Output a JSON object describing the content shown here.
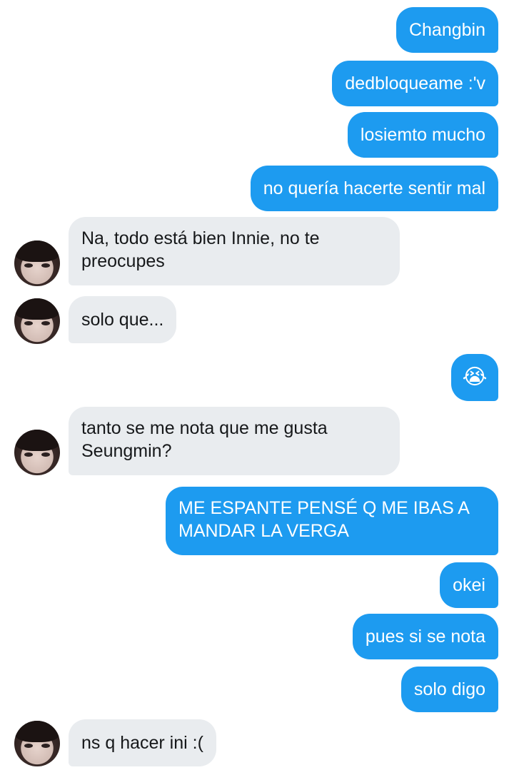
{
  "messages": [
    {
      "from": "me",
      "text": "Changbin"
    },
    {
      "from": "me",
      "text": "dedbloqueame :'v"
    },
    {
      "from": "me",
      "text": "losiemto mucho"
    },
    {
      "from": "me",
      "text": "no quería hacerte sentir mal"
    },
    {
      "from": "them",
      "text": "Na, todo está bien Innie, no te preocupes"
    },
    {
      "from": "them",
      "text": "solo que..."
    },
    {
      "from": "me",
      "text": "😭"
    },
    {
      "from": "them",
      "text": "tanto se me nota que me gusta Seungmin?"
    },
    {
      "from": "me",
      "text": "ME ESPANTE PENSÉ Q ME IBAS A MANDAR LA VERGA"
    },
    {
      "from": "me",
      "text": "okei"
    },
    {
      "from": "me",
      "text": "pues si se nota"
    },
    {
      "from": "me",
      "text": "solo digo"
    },
    {
      "from": "them",
      "text": "ns q hacer ini :("
    }
  ],
  "colors": {
    "sent_bubble": "#1d9bf0",
    "received_bubble": "#e9ecef"
  },
  "icons": {
    "emoji": "loudly-crying-face"
  }
}
